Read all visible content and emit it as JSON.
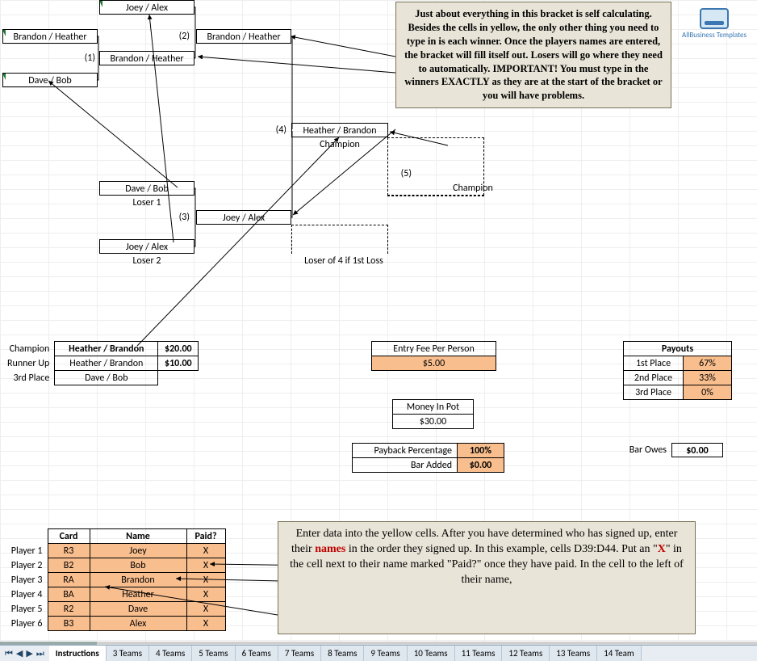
{
  "logo_text": "AllBusiness Templates",
  "bracket": {
    "r1a": "Joey / Alex",
    "r1b": "Brandon / Heather",
    "r1c": "Dave / Bob",
    "seed1": "(1)",
    "seed2": "(2)",
    "winner_r1": "Brandon / Heather",
    "winner_label_r2": "Brandon / Heather",
    "seed4": "(4)",
    "champion_game": "Heather / Brandon",
    "champion_lbl": "Champion",
    "seed5": "(5)",
    "final_champion": "Champion",
    "loser1_team": "Dave / Bob",
    "loser1_lbl": "Loser 1",
    "seed3": "(3)",
    "loser_game": "Joey / Alex",
    "loser2_team": "Joey / Alex",
    "loser2_lbl": "Loser 2",
    "loser_of4": "Loser of 4 if 1st Loss"
  },
  "results": {
    "champion_lbl": "Champion",
    "champion_val": "Heather / Brandon",
    "champion_pay": "$20.00",
    "runner_lbl": "Runner Up",
    "runner_val": "Heather / Brandon",
    "runner_pay": "$10.00",
    "third_lbl": "3rd Place",
    "third_val": "Dave / Bob"
  },
  "fee": {
    "entry_lbl": "Entry Fee Per Person",
    "entry_val": "$5.00",
    "pot_lbl": "Money In Pot",
    "pot_val": "$30.00",
    "payback_lbl": "Payback Percentage",
    "payback_val": "100%",
    "bar_added_lbl": "Bar Added",
    "bar_added_val": "$0.00",
    "bar_owes_lbl": "Bar Owes",
    "bar_owes_val": "$0.00"
  },
  "payouts": {
    "header": "Payouts",
    "r1l": "1st Place",
    "r1v": "67%",
    "r2l": "2nd Place",
    "r2v": "33%",
    "r3l": "3rd Place",
    "r3v": "0%"
  },
  "callout_top": "Just about everything in this bracket is self calculating. Besides the cells in yellow, the only other thing you need to type in is each winner. Once the players names are entered, the bracket will fill itself out. Losers will go where they need to automatically. IMPORTANT! You must type in the winners EXACTLY as they are at the start of the bracket or you will have problems.",
  "callout_bot_pre": "Enter data into the yellow cells. After you have determined who has signed up, enter their ",
  "callout_bot_names": "names",
  "callout_bot_mid": " in the order they signed up. In this example, cells D39:D44. Put an \"",
  "callout_bot_x": "X",
  "callout_bot_post": "\" in the cell next to their name marked \"Paid?\" once they have paid. In the cell to the left of their name,",
  "players": {
    "hdr_card": "Card",
    "hdr_name": "Name",
    "hdr_paid": "Paid?",
    "rows": [
      {
        "lbl": "Player 1",
        "card": "R3",
        "name": "Joey",
        "paid": "X"
      },
      {
        "lbl": "Player 2",
        "card": "B2",
        "name": "Bob",
        "paid": "X"
      },
      {
        "lbl": "Player 3",
        "card": "RA",
        "name": "Brandon",
        "paid": "X"
      },
      {
        "lbl": "Player 4",
        "card": "BA",
        "name": "Heather",
        "paid": "X"
      },
      {
        "lbl": "Player 5",
        "card": "R2",
        "name": "Dave",
        "paid": "X"
      },
      {
        "lbl": "Player 6",
        "card": "B3",
        "name": "Alex",
        "paid": "X"
      }
    ]
  },
  "tabs": [
    "Instructions",
    "3 Teams",
    "4 Teams",
    "5 Teams",
    "6 Teams",
    "7 Teams",
    "8 Teams",
    "9 Teams",
    "10 Teams",
    "11 Teams",
    "12 Teams",
    "13 Teams",
    "14 Team"
  ]
}
